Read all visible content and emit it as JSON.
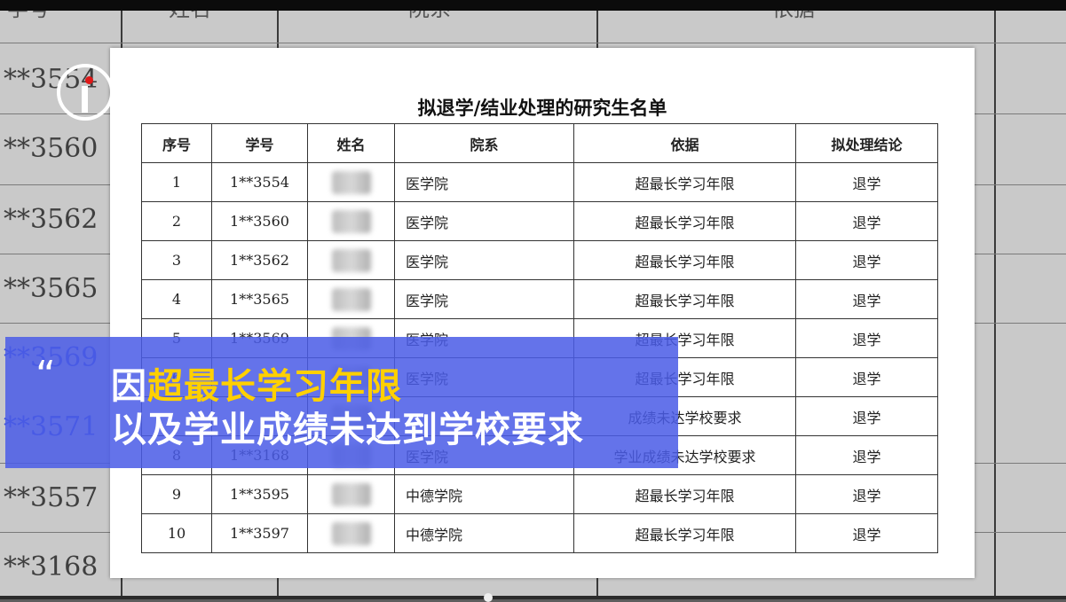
{
  "background": {
    "headers": [
      "学号",
      "姓名",
      "院系",
      "依据"
    ],
    "numbers": [
      {
        "text": "**3554",
        "blue": false
      },
      {
        "text": "**3560",
        "blue": false
      },
      {
        "text": "**3562",
        "blue": false
      },
      {
        "text": "**3565",
        "blue": false
      },
      {
        "text": "**3569",
        "blue": true
      },
      {
        "text": "**3571",
        "blue": true
      },
      {
        "text": "**3557",
        "blue": false
      },
      {
        "text": "**3168",
        "blue": false
      }
    ]
  },
  "document": {
    "title": "拟退学/结业处理的研究生名单",
    "columns": [
      "序号",
      "学号",
      "姓名",
      "院系",
      "依据",
      "拟处理结论"
    ],
    "rows": [
      {
        "no": "1",
        "id": "1**3554",
        "dept": "医学院",
        "basis": "超最长学习年限",
        "result": "退学"
      },
      {
        "no": "2",
        "id": "1**3560",
        "dept": "医学院",
        "basis": "超最长学习年限",
        "result": "退学"
      },
      {
        "no": "3",
        "id": "1**3562",
        "dept": "医学院",
        "basis": "超最长学习年限",
        "result": "退学"
      },
      {
        "no": "4",
        "id": "1**3565",
        "dept": "医学院",
        "basis": "超最长学习年限",
        "result": "退学"
      },
      {
        "no": "5",
        "id": "1**3569",
        "dept": "医学院",
        "basis": "超最长学习年限",
        "result": "退学"
      },
      {
        "no": "6",
        "id": "",
        "dept": "医学院",
        "basis": "超最长学习年限",
        "result": "退学"
      },
      {
        "no": "",
        "id": "",
        "dept": "",
        "basis": "成绩未达学校要求",
        "result": "退学"
      },
      {
        "no": "8",
        "id": "1**3168",
        "dept": "医学院",
        "basis": "学业成绩未达学校要求",
        "result": "退学"
      },
      {
        "no": "9",
        "id": "1**3595",
        "dept": "中德学院",
        "basis": "超最长学习年限",
        "result": "退学"
      },
      {
        "no": "10",
        "id": "1**3597",
        "dept": "中德学院",
        "basis": "超最长学习年限",
        "result": "退学"
      }
    ]
  },
  "caption": {
    "quote_mark": "“",
    "line1_prefix": "因",
    "line1_highlight": "超最长学习年限",
    "line2": "以及学业成绩未达到学校要求",
    "highlight_color": "#ffd000",
    "band_color": "#4a5ce6"
  }
}
